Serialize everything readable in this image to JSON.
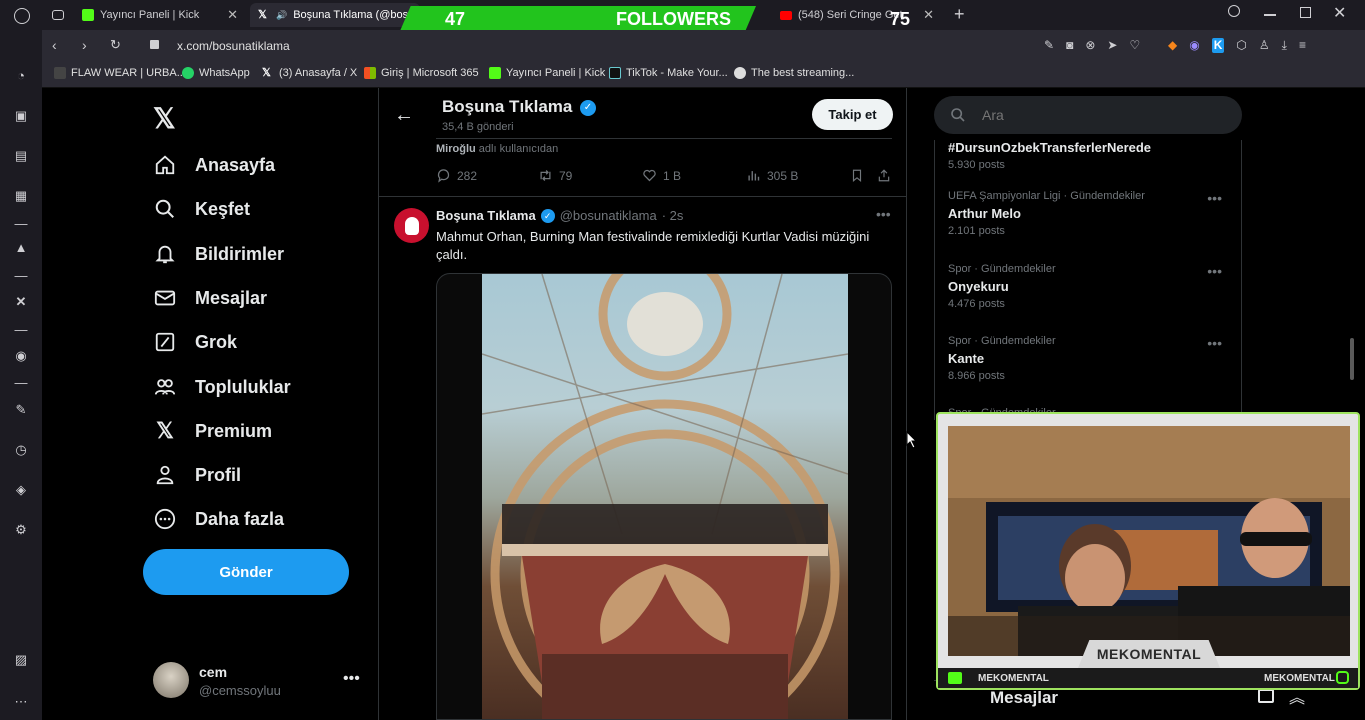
{
  "tabs": [
    {
      "label": "Yayıncı Paneli | Kick",
      "favicon": "kick-icon",
      "color": "#53fc18"
    },
    {
      "label": "Boşuna Tıklama (@bos",
      "favicon": "x-icon",
      "color": "#ffffff",
      "active": true
    },
    {
      "label": "(548) Seri Cringe Get",
      "favicon": "youtube-icon",
      "color": "#ff0000"
    }
  ],
  "overlay": {
    "left_count": "47",
    "label": "FOLLOWERS",
    "right_count": "75"
  },
  "address": {
    "url": "x.com/bosunatiklama"
  },
  "bookmarks": [
    {
      "label": "FLAW WEAR | URBA...",
      "icon": "store-icon"
    },
    {
      "label": "WhatsApp",
      "icon": "whatsapp-icon"
    },
    {
      "label": "(3) Anasayfa / X",
      "icon": "x-icon"
    },
    {
      "label": "Giriş | Microsoft 365",
      "icon": "microsoft-icon"
    },
    {
      "label": "Yayıncı Paneli | Kick",
      "icon": "kick-icon"
    },
    {
      "label": "TikTok - Make Your...",
      "icon": "tiktok-icon"
    },
    {
      "label": "The best streaming...",
      "icon": "streaming-icon"
    }
  ],
  "left_nav": {
    "items": [
      "Anasayfa",
      "Keşfet",
      "Bildirimler",
      "Mesajlar",
      "Grok",
      "Topluluklar",
      "Premium",
      "Profil",
      "Daha fazla"
    ],
    "post_button": "Gönder",
    "user": {
      "name": "cem",
      "handle": "@cemssoyluu"
    }
  },
  "profile_header": {
    "name": "Boşuna Tıklama",
    "posts": "35,4 B gönderi",
    "follow_label": "Takip et"
  },
  "prev_tweet": {
    "note_name": "Miroğlu",
    "note_text": "adlı kullanıcıdan",
    "replies": "282",
    "retweets": "79",
    "likes": "1 B",
    "views": "305 B"
  },
  "tweet": {
    "name": "Boşuna Tıklama",
    "handle": "@bosunatiklama",
    "time": "· 2s",
    "text": "Mahmut Orhan, Burning Man festivalinde remixlediği Kurtlar Vadisi müziğini çaldı."
  },
  "search": {
    "placeholder": "Ara"
  },
  "trends": [
    {
      "category": "",
      "name": "#DursunOzbekTransferlerNerede",
      "count": "5.930 posts"
    },
    {
      "category": "UEFA Şampiyonlar Ligi · Gündemdekiler",
      "name": "Arthur Melo",
      "count": "2.101 posts"
    },
    {
      "category": "Spor · Gündemdekiler",
      "name": "Onyekuru",
      "count": "4.476 posts"
    },
    {
      "category": "Spor · Gündemdekiler",
      "name": "Kante",
      "count": "8.966 posts"
    },
    {
      "category": "Spor · Gündemdekiler",
      "name": "",
      "count": ""
    }
  ],
  "messages_bar": {
    "label": "Mesajlar"
  },
  "webcam": {
    "title": "MEKOMENTAL",
    "left_tag": "MEKOMENTAL",
    "right_tag": "MEKOMENTAL"
  },
  "colors": {
    "accent": "#1d9bf0",
    "kick_green": "#53fc18",
    "bg": "#000000"
  }
}
